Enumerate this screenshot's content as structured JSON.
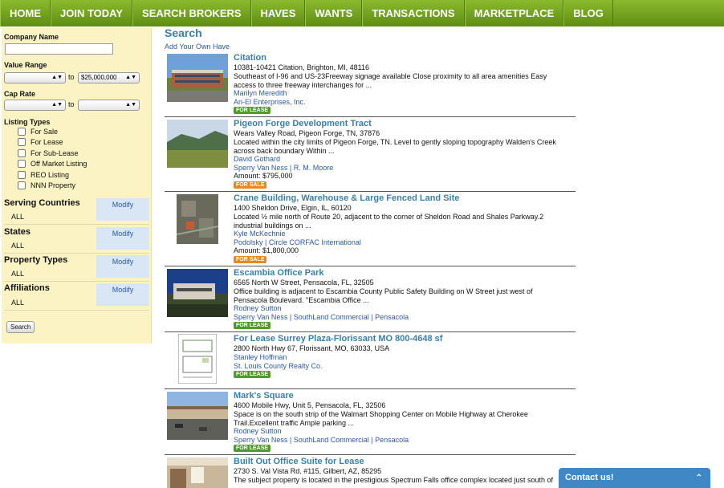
{
  "nav": [
    "HOME",
    "JOIN TODAY",
    "SEARCH BROKERS",
    "HAVES",
    "WANTS",
    "TRANSACTIONS",
    "MARKETPLACE",
    "BLOG"
  ],
  "sidebar": {
    "company_name_label": "Company Name",
    "value_range_label": "Value Range",
    "value_min": "",
    "value_max": "$25,000,000",
    "to": "to",
    "cap_rate_label": "Cap Rate",
    "cap_min": "",
    "cap_max": "",
    "listing_types_label": "Listing Types",
    "listing_types": [
      "For Sale",
      "For Lease",
      "For Sub-Lease",
      "Off Market Listing",
      "REO Listing",
      "NNN Property"
    ],
    "sections": [
      {
        "title": "Serving Countries",
        "value": "ALL",
        "modify": "Modify"
      },
      {
        "title": "States",
        "value": "ALL",
        "modify": "Modify"
      },
      {
        "title": "Property Types",
        "value": "ALL",
        "modify": "Modify"
      },
      {
        "title": "Affiliations",
        "value": "ALL",
        "modify": "Modify"
      }
    ],
    "search_button": "Search"
  },
  "main": {
    "title": "Search",
    "add_link": "Add Your Own Have",
    "listings": [
      {
        "title": "Citation",
        "address": "10381-10421 Citation, Brighton, MI, 48116",
        "desc1": "Southeast of I-96 and US-23Freeway signage available Close proximity to all area amenities Easy",
        "desc2": "access to three freeway interchanges for ...",
        "agent": "Marilyn Meredith",
        "company": "Ari-El Enterprises, Inc.",
        "amount": "",
        "badge": "FOR LEASE"
      },
      {
        "title": "Pigeon Forge Development Tract",
        "address": "Wears Valley Road, Pigeon Forge, TN, 37876",
        "desc1": "Located within the city limits of Pigeon Forge, TN. Level to gently sloping topography Walden's Creek",
        "desc2": "across back boundary Within ...",
        "agent": "David Gothard",
        "company": "Sperry Van Ness | R. M. Moore",
        "amount": "Amount: $795,000",
        "badge": "FOR SALE"
      },
      {
        "title": "Crane Building, Warehouse & Large Fenced Land Site",
        "address": "1400 Sheldon Drive, Elgin, IL, 60120",
        "desc1": "Located ½ mile north of Route 20, adjacent to the corner of Sheldon Road and Shales Parkway.2",
        "desc2": "industrial buildings on ...",
        "agent": "Kyle McKechnie",
        "company": "Podolsky | Circle CORFAC International",
        "amount": "Amount: $1,800,000",
        "badge": "FOR SALE"
      },
      {
        "title": "Escambia Office Park",
        "address": "6565 North W Street, Pensacola, FL, 32505",
        "desc1": "Office building is adjacent to Escambia County Public Safety Building on W Street just west of",
        "desc2": "Pensacola Boulevard. \"Escambia Office ...",
        "agent": "Rodney Sutton",
        "company": "Sperry Van Ness | SouthLand Commercial | Pensacola",
        "amount": "",
        "badge": "FOR LEASE"
      },
      {
        "title": "For Lease Surrey Plaza-Florissant MO 800-4648 sf",
        "address": "2800 North Hwy 67, Florissant, MO, 63033, USA",
        "desc1": "",
        "desc2": "",
        "agent": "Stanley Hoffman",
        "company": "St. Louis County Realty Co.",
        "amount": "",
        "badge": "FOR LEASE"
      },
      {
        "title": "Mark's Square",
        "address": "4600 Mobile Hwy, Unit 5, Pensacola, FL, 32506",
        "desc1": "Space is on the south strip of the Walmart Shopping Center on Mobile Highway at Cherokee",
        "desc2": "Trail.Excellent traffic Ample parking ...",
        "agent": "Rodney Sutton",
        "company": "Sperry Van Ness | SouthLand Commercial | Pensacola",
        "amount": "",
        "badge": "FOR LEASE"
      },
      {
        "title": "Built Out Office Suite for Lease",
        "address": "2730 S. Val Vista Rd. #115, Gilbert, AZ, 85295",
        "desc1": "The subject property is located in the prestigious Spectrum Falls office complex located just south of",
        "desc2": "",
        "agent": "",
        "company": "",
        "amount": "",
        "badge": ""
      }
    ]
  },
  "contact": {
    "label": "Contact us!"
  }
}
